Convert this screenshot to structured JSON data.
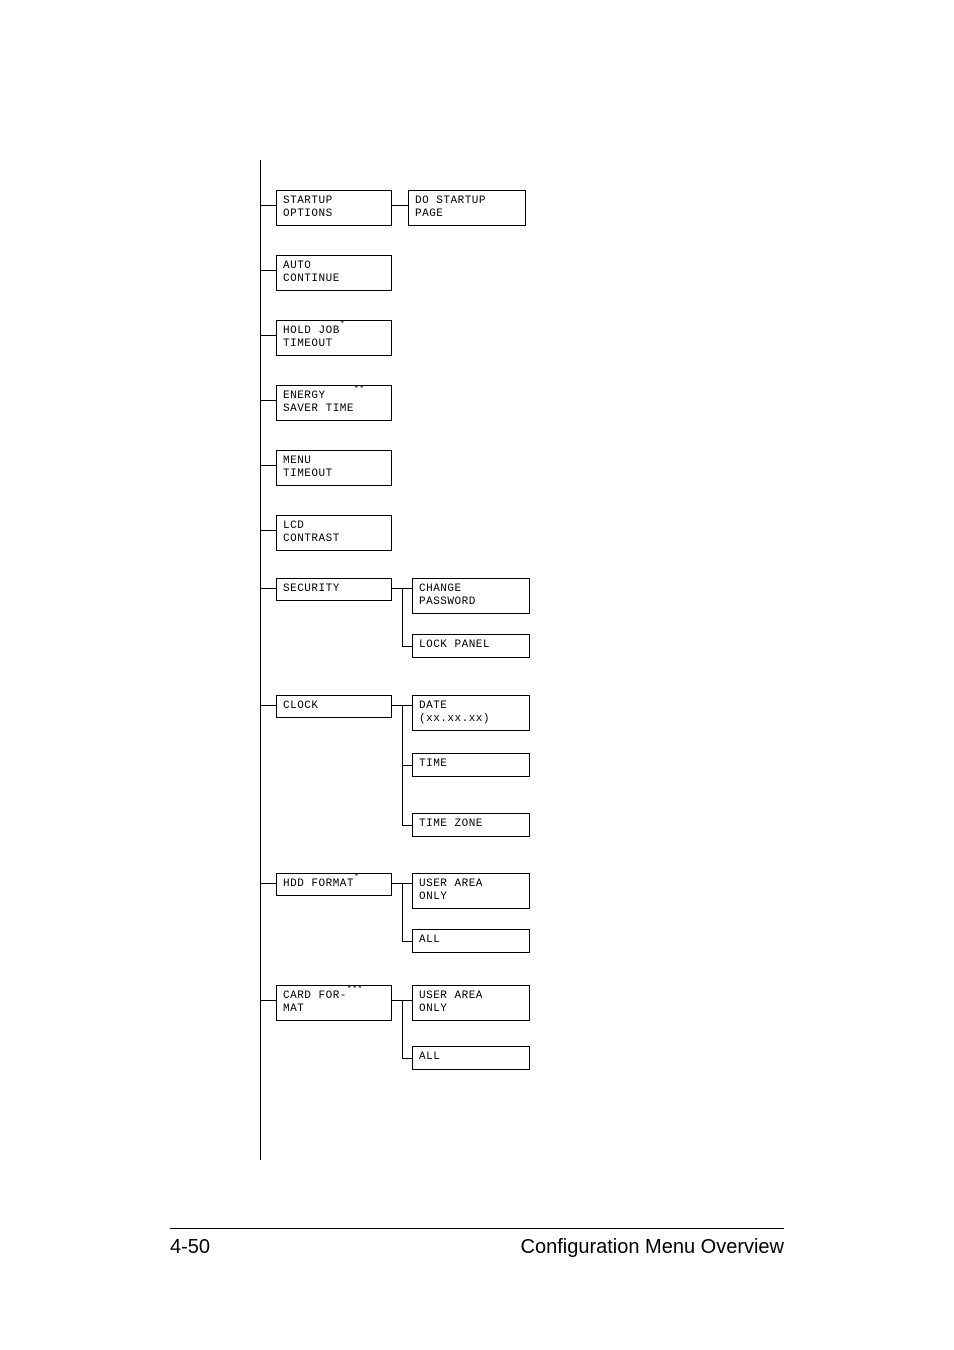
{
  "menu": {
    "startup_options": "STARTUP\nOPTIONS",
    "do_startup_page": "DO STARTUP\nPAGE",
    "auto_continue": "AUTO\nCONTINUE",
    "hold_job_timeout": "HOLD JOB\nTIMEOUT",
    "hold_job_timeout_sup": "*",
    "energy_saver_time": "ENERGY\nSAVER TIME",
    "energy_saver_time_sup": "**",
    "menu_timeout": "MENU\nTIMEOUT",
    "lcd_contrast": "LCD\nCONTRAST",
    "security": "SECURITY",
    "change_password": "CHANGE\nPASSWORD",
    "lock_panel": "LOCK PANEL",
    "clock": "CLOCK",
    "date": "DATE\n(xx.xx.xx)",
    "time": "TIME",
    "time_zone": "TIME ZONE",
    "hdd_format": "HDD FORMAT",
    "hdd_format_sup": "*",
    "user_area_only_1": "USER AREA\nONLY",
    "all_1": "ALL",
    "card_format": "CARD FOR-\nMAT",
    "card_format_sup": "***",
    "user_area_only_2": "USER AREA\nONLY",
    "all_2": "ALL"
  },
  "footer": {
    "page_num": "4-50",
    "title": "Configuration Menu Overview"
  }
}
